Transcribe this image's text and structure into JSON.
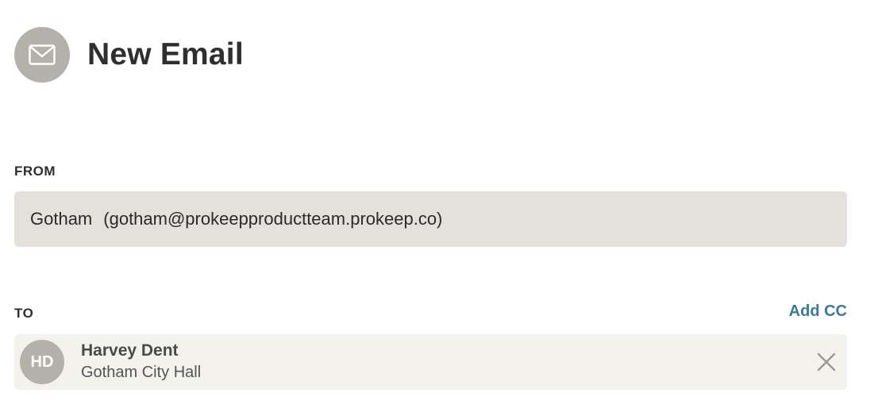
{
  "header": {
    "icon": "mail-icon",
    "title": "New Email"
  },
  "from": {
    "label": "FROM",
    "sender_name": "Gotham",
    "sender_email": "(gotham@prokeepproductteam.prokeep.co)"
  },
  "to": {
    "label": "TO",
    "add_cc_label": "Add CC",
    "recipients": [
      {
        "initials": "HD",
        "name": "Harvey Dent",
        "organization": "Gotham City Hall",
        "remove_icon": "close-icon"
      }
    ]
  },
  "colors": {
    "icon_circle": "#b4b0aa",
    "from_field_bg": "#e4e1dd",
    "recipient_chip_bg": "#f4f2ed",
    "link_accent": "#3b7a96"
  }
}
